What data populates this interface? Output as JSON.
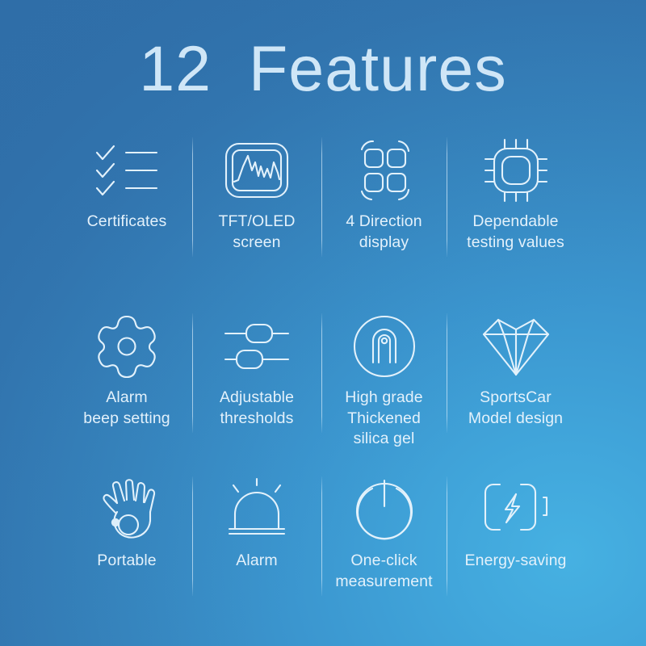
{
  "header": {
    "title": "12  Features",
    "title_color": "#cfe6f7"
  },
  "theme": {
    "background_top_left": "#3479b4",
    "background_bottom_right": "#3fa9dc",
    "icon_stroke": "#e2f1fb",
    "label_color": "#e3f1fb",
    "divider_color": "#def0fc"
  },
  "features": [
    {
      "id": 1,
      "icon": "checklist-icon",
      "label": "Certificates",
      "row": 1,
      "column": 1
    },
    {
      "id": 2,
      "icon": "waveform-screen-icon",
      "label": "TFT/OLED\nscreen",
      "row": 1,
      "column": 2
    },
    {
      "id": 3,
      "icon": "four-direction-rotate-icon",
      "label": "4 Direction\ndisplay",
      "row": 1,
      "column": 3
    },
    {
      "id": 4,
      "icon": "cpu-chip-icon",
      "label": "Dependable\ntesting values",
      "row": 1,
      "column": 4
    },
    {
      "id": 5,
      "icon": "gear-icon",
      "label": "Alarm\nbeep setting",
      "row": 2,
      "column": 1
    },
    {
      "id": 6,
      "icon": "sliders-icon",
      "label": "Adjustable\nthresholds",
      "row": 2,
      "column": 2
    },
    {
      "id": 7,
      "icon": "fingerprint-circle-icon",
      "label": "High grade\nThickened\nsilica gel",
      "row": 2,
      "column": 3
    },
    {
      "id": 8,
      "icon": "diamond-gem-icon",
      "label": "SportsCar\nModel design",
      "row": 2,
      "column": 4
    },
    {
      "id": 9,
      "icon": "ok-hand-icon",
      "label": "Portable",
      "row": 3,
      "column": 1
    },
    {
      "id": 10,
      "icon": "alarm-dome-icon",
      "label": "Alarm",
      "row": 3,
      "column": 2
    },
    {
      "id": 11,
      "icon": "power-button-icon",
      "label": "One-click\nmeasurement",
      "row": 3,
      "column": 3
    },
    {
      "id": 12,
      "icon": "battery-bolt-icon",
      "label": "Energy-saving",
      "row": 3,
      "column": 4
    }
  ]
}
